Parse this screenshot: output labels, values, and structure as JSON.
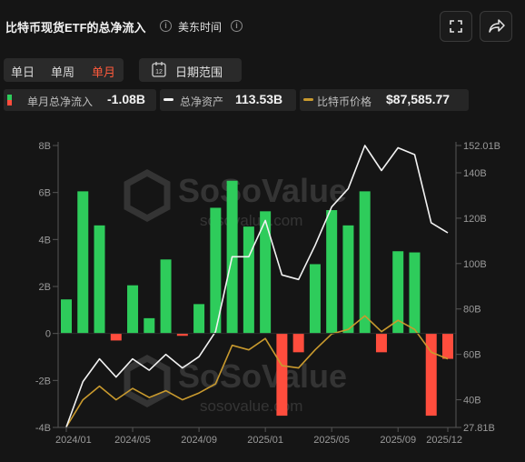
{
  "header": {
    "title": "比特币现货ETF的总净流入",
    "timezone": "美东时间",
    "info_icon": "i"
  },
  "toolbar": {
    "periods": [
      "单日",
      "单周",
      "单月"
    ],
    "active_period": "单月",
    "date_range_label": "日期范围",
    "calendar_day": "12"
  },
  "legend": {
    "flow": {
      "label": "单月总净流入",
      "value": "-1.08B"
    },
    "assets": {
      "label": "总净资产",
      "value": "113.53B"
    },
    "price": {
      "label": "比特币价格",
      "value": "$87,585.77"
    }
  },
  "watermark": {
    "brand": "SoSoValue",
    "site": "sosovalue.com"
  },
  "colors": {
    "positive": "#2ecc5b",
    "negative": "#ff4d3d",
    "assets_line": "#f2f2f2",
    "price_line": "#c99a2e",
    "accent": "#ff5a3c"
  },
  "chart_data": {
    "type": "bar",
    "grid": false,
    "x_tick_labels": [
      "2024/01",
      "2024/05",
      "2024/09",
      "2025/01",
      "2025/05",
      "2025/09",
      "2025/12"
    ],
    "left_axis": {
      "ticks": [
        "8B",
        "6B",
        "4B",
        "2B",
        "0",
        "-2B",
        "-4B"
      ],
      "ylim": [
        -4,
        8
      ]
    },
    "right_axis": {
      "ticks": [
        "152.01B",
        "140B",
        "120B",
        "100B",
        "80B",
        "60B",
        "40B",
        "27.81B"
      ],
      "ylim": [
        27.81,
        152.01
      ]
    },
    "categories": [
      "2024/01",
      "2024/02",
      "2024/03",
      "2024/04",
      "2024/05",
      "2024/06",
      "2024/07",
      "2024/08",
      "2024/09",
      "2024/10",
      "2024/11",
      "2024/12",
      "2025/01",
      "2025/02",
      "2025/03",
      "2025/04",
      "2025/05",
      "2025/06",
      "2025/07",
      "2025/08",
      "2025/09",
      "2025/10",
      "2025/11",
      "2025/12"
    ],
    "series": [
      {
        "name": "单月总净流入",
        "type": "bar",
        "values": [
          1.45,
          6.05,
          4.6,
          -0.3,
          2.05,
          0.65,
          3.15,
          -0.1,
          1.25,
          5.35,
          6.5,
          4.55,
          5.2,
          -3.5,
          -0.8,
          2.95,
          5.25,
          4.6,
          6.05,
          -0.8,
          3.5,
          3.45,
          -3.5,
          -1.08
        ]
      },
      {
        "name": "总净资产",
        "type": "line",
        "values": [
          28,
          48,
          58,
          50,
          58,
          53,
          60,
          54,
          59,
          70,
          103,
          103,
          119,
          95,
          93,
          108,
          125,
          133,
          152,
          141,
          151,
          148,
          118,
          113.53
        ]
      },
      {
        "name": "比特币价格",
        "type": "line",
        "values": [
          28,
          40,
          46,
          40,
          45,
          41,
          44,
          40,
          43,
          47,
          64,
          62,
          67,
          55,
          54,
          62,
          69,
          71,
          77,
          70,
          75,
          71,
          61,
          58
        ]
      }
    ]
  }
}
